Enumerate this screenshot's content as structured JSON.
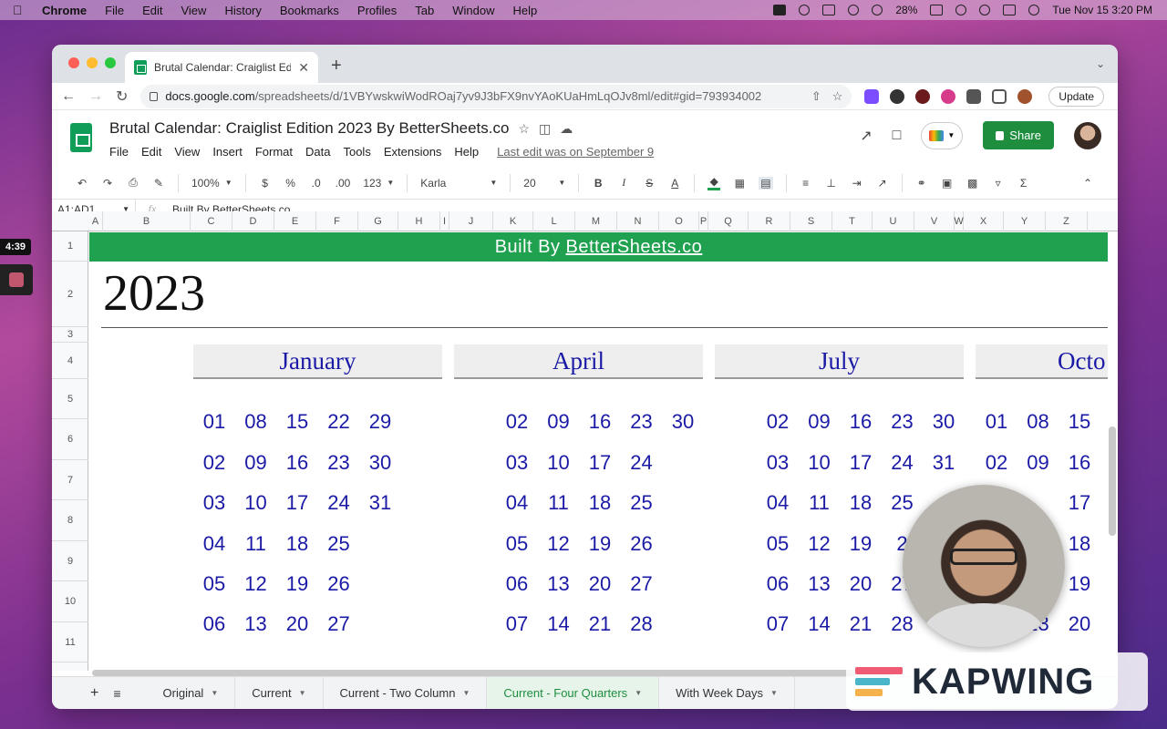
{
  "menubar": {
    "app_name": "Chrome",
    "items": [
      "File",
      "Edit",
      "View",
      "History",
      "Bookmarks",
      "Profiles",
      "Tab",
      "Window",
      "Help"
    ],
    "battery": "28%",
    "datetime": "Tue Nov 15  3:20 PM"
  },
  "overlay": {
    "timer": "4:39",
    "logo_text": "KAPWING"
  },
  "browser": {
    "tab_title": "Brutal Calendar: Craiglist Editio",
    "url_host": "docs.google.com",
    "url_path": "/spreadsheets/d/1VBYwskwiWodROaj7yv9J3bFX9nvYAoKUaHmLqOJv8ml/edit#gid=793934002",
    "update_label": "Update"
  },
  "doc": {
    "title": "Brutal Calendar: Craiglist Edition 2023 By BetterSheets.co",
    "menu": [
      "File",
      "Edit",
      "View",
      "Insert",
      "Format",
      "Data",
      "Tools",
      "Extensions",
      "Help"
    ],
    "last_edit": "Last edit was on September 9",
    "share_label": "Share"
  },
  "toolbar": {
    "zoom": "100%",
    "currency": "$",
    "percent": "%",
    "dec_less": ".0",
    "dec_more": ".00",
    "number_format": "123",
    "font": "Karla",
    "font_size": "20"
  },
  "formula_bar": {
    "cell_ref": "A1:AD1",
    "fx": "fx",
    "value": "Built By BetterSheets.co"
  },
  "columns": [
    "A",
    "B",
    "C",
    "D",
    "E",
    "F",
    "G",
    "H",
    "I",
    "J",
    "K",
    "L",
    "M",
    "N",
    "O",
    "P",
    "Q",
    "R",
    "S",
    "T",
    "U",
    "V",
    "W",
    "X",
    "Y",
    "Z"
  ],
  "rows": [
    "1",
    "2",
    "3",
    "4",
    "5",
    "6",
    "7",
    "8",
    "9",
    "10",
    "11"
  ],
  "sheet": {
    "banner_prefix": "Built By",
    "banner_link": "BetterSheets.co",
    "year": "2023",
    "months": [
      {
        "name": "January",
        "cols": [
          [
            "01",
            "02",
            "03",
            "04",
            "05",
            "06"
          ],
          [
            "08",
            "09",
            "10",
            "11",
            "12",
            "13"
          ],
          [
            "15",
            "16",
            "17",
            "18",
            "19",
            "20"
          ],
          [
            "22",
            "23",
            "24",
            "25",
            "26",
            "27"
          ],
          [
            "29",
            "30",
            "31"
          ]
        ]
      },
      {
        "name": "April",
        "cols": [
          [
            "02",
            "03",
            "04",
            "05",
            "06",
            "07"
          ],
          [
            "09",
            "10",
            "11",
            "12",
            "13",
            "14"
          ],
          [
            "16",
            "17",
            "18",
            "19",
            "20",
            "21"
          ],
          [
            "23",
            "24",
            "25",
            "26",
            "27",
            "28"
          ],
          [
            "30"
          ]
        ]
      },
      {
        "name": "July",
        "cols": [
          [
            "02",
            "03",
            "04",
            "05",
            "06",
            "07"
          ],
          [
            "09",
            "10",
            "11",
            "12",
            "13",
            "14"
          ],
          [
            "16",
            "17",
            "18",
            "19",
            "20",
            "21"
          ],
          [
            "23",
            "24",
            "25",
            "2",
            "27",
            "28"
          ],
          [
            "30",
            "31"
          ]
        ]
      },
      {
        "name": "Octo",
        "cols": [
          [
            "01",
            "02"
          ],
          [
            "08",
            "09",
            "",
            "",
            "",
            "13"
          ],
          [
            "15",
            "16",
            "17",
            "18",
            "19",
            "20"
          ]
        ]
      }
    ]
  },
  "sheet_tabs": [
    {
      "label": "Original",
      "active": false
    },
    {
      "label": "Current",
      "active": false
    },
    {
      "label": "Current - Two Column",
      "active": false
    },
    {
      "label": "Current - Four Quarters",
      "active": true
    },
    {
      "label": "With Week Days",
      "active": false
    }
  ]
}
